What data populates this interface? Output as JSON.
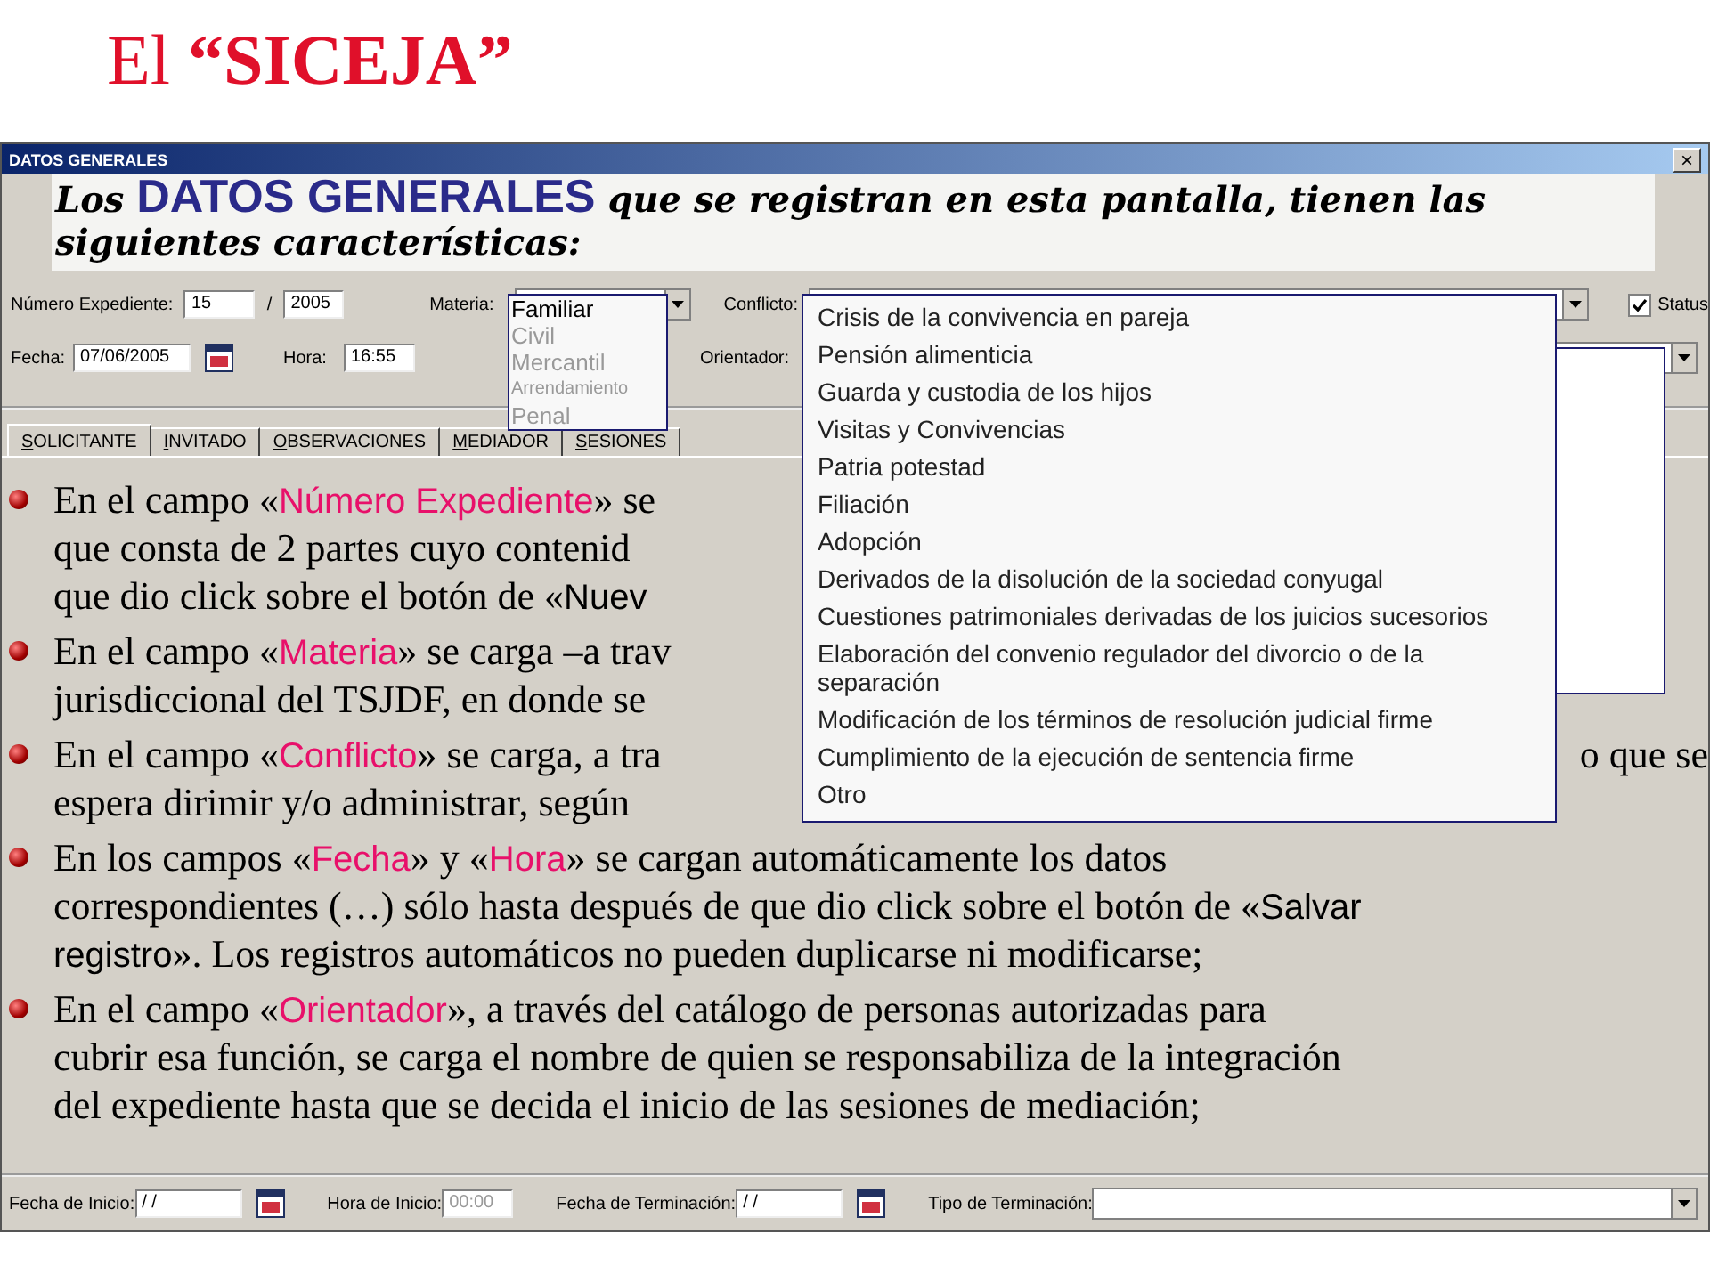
{
  "slide_title": {
    "lead": "El",
    "name": "“SICEJA”"
  },
  "window": {
    "title": "DATOS GENERALES",
    "close": "×"
  },
  "heading": {
    "lead": "Los",
    "highlight": "DATOS GENERALES",
    "rest": "que se registran en esta pantalla, tienen las siguientes características:"
  },
  "form": {
    "numero_label": "Número Expediente:",
    "numero": "15",
    "separator": "/",
    "anio": "2005",
    "materia_label": "Materia:",
    "conflicto_label": "Conflicto:",
    "status": {
      "label": "Status",
      "checked": true
    },
    "fecha_label": "Fecha:",
    "fecha": "07/06/2005",
    "hora_label": "Hora:",
    "hora": "16:55",
    "orientador_label": "Orientador:"
  },
  "materia_options": [
    {
      "label": "Familiar",
      "selected": true
    },
    {
      "label": "Civil",
      "selected": false
    },
    {
      "label": "Mercantil",
      "selected": false
    },
    {
      "label": "Arrendamiento",
      "selected": false
    },
    {
      "label": "Penal",
      "selected": false
    }
  ],
  "conflicto_options": [
    "Crisis de la convivencia en pareja",
    "Pensión alimenticia",
    "Guarda y custodia de los hijos",
    "Visitas y Convivencias",
    "Patria potestad",
    "Filiación",
    "Adopción",
    "Derivados de la disolución de la sociedad conyugal",
    "Cuestiones patrimoniales derivadas de los juicios sucesorios",
    "Elaboración del convenio regulador del divorcio o de la separación",
    "Modificación de los términos de resolución judicial firme",
    "Cumplimiento de la ejecución de sentencia firme",
    "Otro"
  ],
  "tabs": [
    {
      "label": "SOLICITANTE",
      "selected": true
    },
    {
      "label": "INVITADO",
      "selected": false
    },
    {
      "label": "OBSERVACIONES",
      "selected": false
    },
    {
      "label": "MEDIADOR",
      "selected": false
    },
    {
      "label": "SESIONES",
      "selected": false
    }
  ],
  "bullets": [
    {
      "lines": [
        {
          "left": [
            {
              "kind": "plain",
              "text": "En el campo «"
            },
            {
              "kind": "field",
              "text": "Número Expediente"
            },
            {
              "kind": "plain",
              "text": "» se"
            }
          ]
        },
        {
          "left": [
            {
              "kind": "plain",
              "text": "que consta de 2 partes cuyo contenid"
            }
          ]
        },
        {
          "left": [
            {
              "kind": "plain",
              "text": "que dio click sobre el botón de «"
            },
            {
              "kind": "button",
              "text": "Nuev"
            }
          ]
        }
      ]
    },
    {
      "lines": [
        {
          "left": [
            {
              "kind": "plain",
              "text": "En el campo «"
            },
            {
              "kind": "field",
              "text": "Materia"
            },
            {
              "kind": "plain",
              "text": "» se carga –a trav"
            }
          ]
        },
        {
          "left": [
            {
              "kind": "plain",
              "text": "jurisdiccional del TSJDF, en donde se"
            }
          ]
        }
      ]
    },
    {
      "lines": [
        {
          "left": [
            {
              "kind": "plain",
              "text": "En el campo «"
            },
            {
              "kind": "field",
              "text": "Conflicto"
            },
            {
              "kind": "plain",
              "text": "» se carga, a tra"
            }
          ],
          "right": "o que se"
        },
        {
          "left": [
            {
              "kind": "plain",
              "text": "espera dirimir y/o administrar, según"
            }
          ]
        }
      ]
    },
    {
      "lines": [
        {
          "left": [
            {
              "kind": "plain",
              "text": "En los campos «"
            },
            {
              "kind": "field",
              "text": "Fecha"
            },
            {
              "kind": "plain",
              "text": "» y «"
            },
            {
              "kind": "field",
              "text": "Hora"
            },
            {
              "kind": "plain",
              "text": "» se cargan automáticamente los datos"
            }
          ]
        },
        {
          "left": [
            {
              "kind": "plain",
              "text": "correspondientes (…) sólo hasta después de que dio click sobre el botón de «"
            },
            {
              "kind": "button",
              "text": "Salvar"
            }
          ]
        },
        {
          "left": [
            {
              "kind": "button",
              "text": "registro"
            },
            {
              "kind": "plain",
              "text": "». Los registros automáticos no pueden duplicarse ni modificarse;"
            }
          ]
        }
      ]
    },
    {
      "lines": [
        {
          "left": [
            {
              "kind": "plain",
              "text": "En el campo «"
            },
            {
              "kind": "field",
              "text": "Orientador"
            },
            {
              "kind": "plain",
              "text": "», a través del catálogo de personas autorizadas para"
            }
          ]
        },
        {
          "left": [
            {
              "kind": "plain",
              "text": "cubrir esa función, se carga el nombre de quien se responsabiliza de la integración"
            }
          ]
        },
        {
          "left": [
            {
              "kind": "plain",
              "text": "del expediente hasta que se decida el inicio de las sesiones de mediación;"
            }
          ]
        }
      ]
    }
  ],
  "footer": {
    "inicio_label": "Fecha de Inicio:",
    "inicio": "/ /",
    "hora_label": "Hora de Inicio:",
    "hora": "00:00",
    "termino_label": "Fecha de Terminación:",
    "termino": "/ /",
    "tipo_label": "Tipo de Terminación:"
  }
}
